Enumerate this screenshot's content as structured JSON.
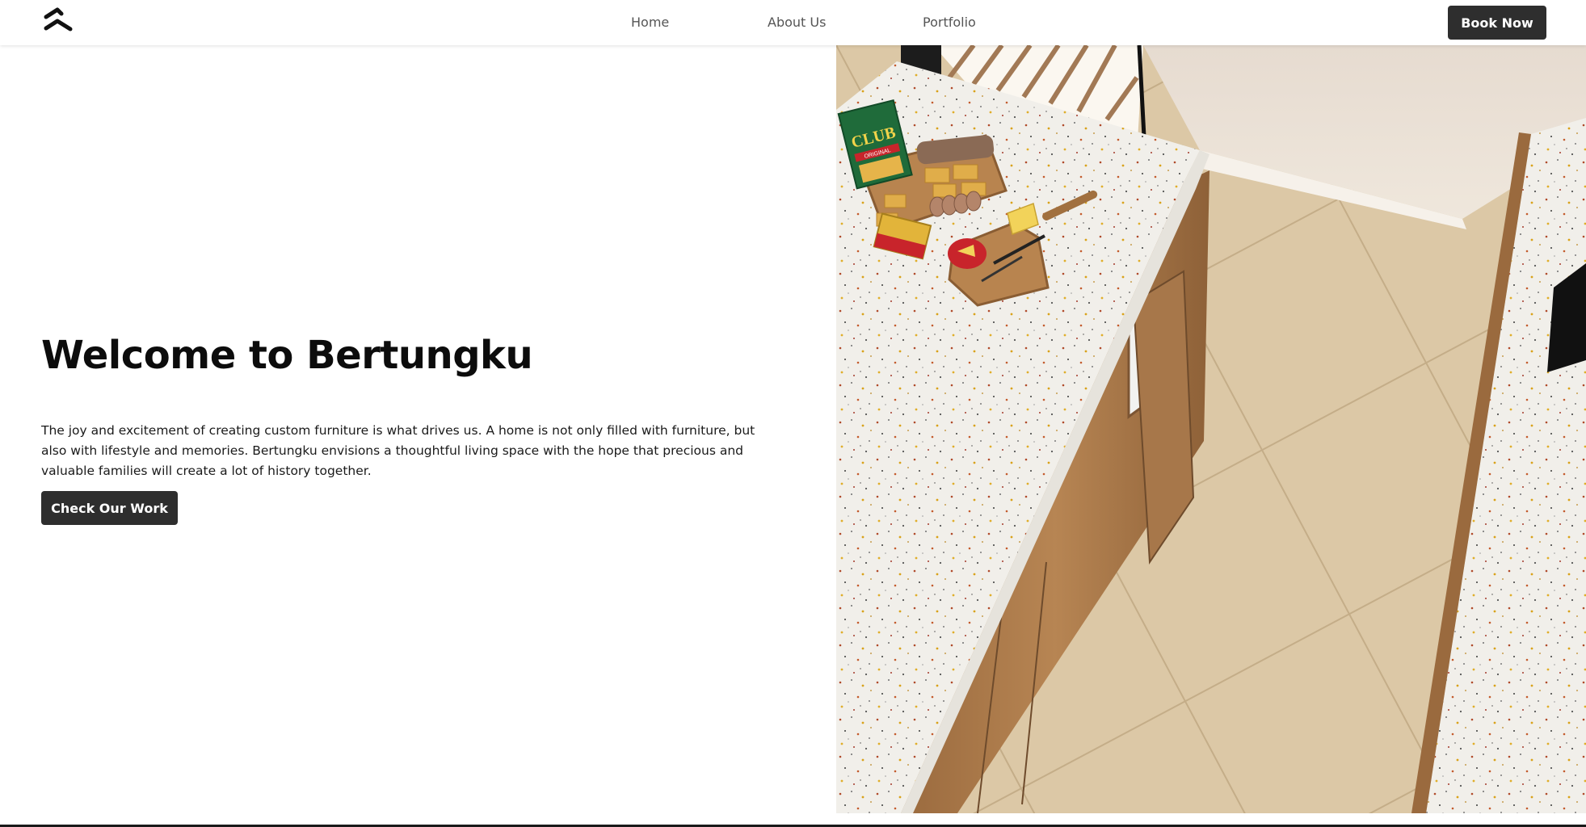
{
  "header": {
    "logo_icon": "brand-wave-icon",
    "nav": [
      {
        "label": "Home"
      },
      {
        "label": "About Us"
      },
      {
        "label": "Portfolio"
      }
    ],
    "book_label": "Book Now"
  },
  "hero": {
    "title": "Welcome to Bertungku",
    "description": "The joy and excitement of creating custom furniture is what drives us. A home is not only filled with furniture, but also with lifestyle and memories. Bertungku envisions a thoughtful living space with the hope that precious and valuable families will create a lot of history together.",
    "cta_label": "Check Our Work"
  },
  "image": {
    "cracker_box_brand": "CLUB",
    "cracker_box_variant": "ORIGINAL"
  },
  "colors": {
    "button_bg": "#2e2e2e",
    "button_text": "#ffffff",
    "nav_text": "#555555",
    "title_text": "#0c0c0c"
  }
}
